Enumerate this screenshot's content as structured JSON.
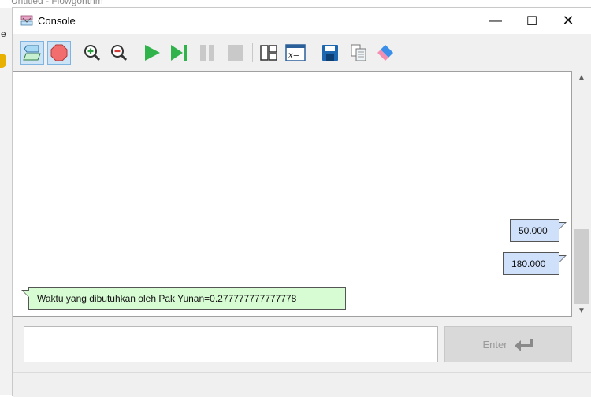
{
  "background_window": {
    "title": "Untitled - Flowgorithm",
    "left_char": "e"
  },
  "window": {
    "title": "Console",
    "minimize": "—",
    "maximize": "☐",
    "close": "✕"
  },
  "toolbar": {
    "buttons": [
      "flowchart-toggle-icon",
      "stop-icon",
      "zoom-in-icon",
      "zoom-out-icon",
      "run-icon",
      "step-icon",
      "pause-icon",
      "stop-square-icon",
      "layout-icon",
      "variables-icon",
      "save-icon",
      "copy-icon",
      "eraser-icon"
    ]
  },
  "output": {
    "messages": [
      {
        "text": "50.000",
        "type": "input"
      },
      {
        "text": "180.000",
        "type": "input"
      },
      {
        "text": "Waktu yang dibutuhkan oleh Pak Yunan=0.277777777777778",
        "type": "output"
      }
    ]
  },
  "input": {
    "value": "",
    "placeholder": ""
  },
  "enter_button": {
    "label": "Enter"
  },
  "colors": {
    "input_bubble": "#cfe0fb",
    "output_bubble": "#d7fbd3",
    "run_green": "#2fb34a"
  }
}
